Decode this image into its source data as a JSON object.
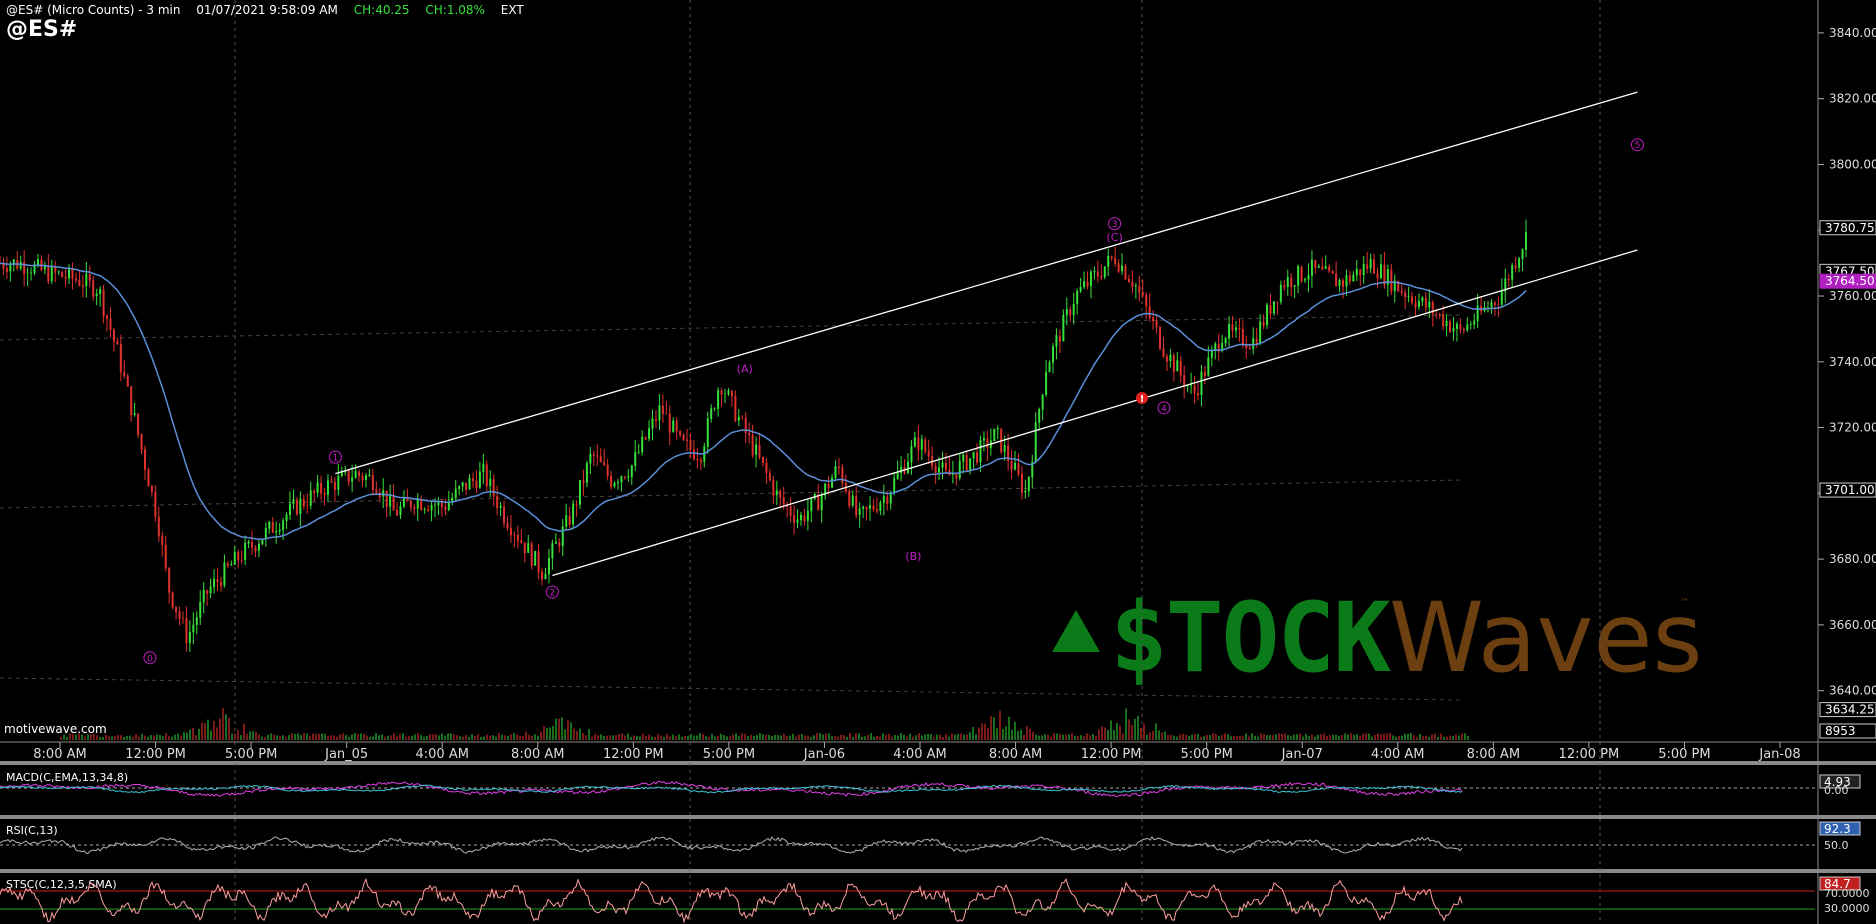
{
  "header": {
    "title": "@ES# (Micro Counts) - 3 min",
    "datetime": "01/07/2021 9:58:09 AM",
    "change": "CH:40.25",
    "change_pct": "CH:1.08%",
    "session": "EXT",
    "symbol": "@ES#"
  },
  "watermark": {
    "source": "motivewave.com",
    "logo_stock": "$TOCK",
    "logo_waves": "Waves",
    "logo_tm": "™"
  },
  "colors": {
    "background": "#000000",
    "up_candle": "#37e13c",
    "down_candle": "#e0322d",
    "ma_line": "#5b8fd8",
    "wave_label": "#c21dc6",
    "channel": "#ffffff",
    "macd": "#e040e8",
    "rsi": "#b0b0b0",
    "stoch": "#ff9f9f"
  },
  "chart_data": {
    "type": "candlestick",
    "title": "@ES# (Micro Counts) - 3 min",
    "ylim": [
      3625,
      3850
    ],
    "y_ticks": [
      3640,
      3660,
      3680,
      3700,
      3720,
      3740,
      3760,
      3780,
      3800,
      3820,
      3840
    ],
    "x_ticks": [
      "8:00 AM",
      "12:00 PM",
      "5:00 PM",
      "Jan_05",
      "4:00 AM",
      "8:00 AM",
      "12:00 PM",
      "5:00 PM",
      "Jan-06",
      "4:00 AM",
      "8:00 AM",
      "12:00 PM",
      "5:00 PM",
      "Jan-07",
      "4:00 AM",
      "8:00 AM",
      "12:00 PM",
      "5:00 PM",
      "Jan-08"
    ],
    "price_labels": [
      {
        "text": "3780.75",
        "value": 3780.75,
        "style": "last"
      },
      {
        "text": "3767.50",
        "value": 3767.5,
        "style": "plain"
      },
      {
        "text": "3764.50",
        "value": 3764.5,
        "style": "magenta"
      },
      {
        "text": "3701.00",
        "value": 3701.0,
        "style": "plain"
      },
      {
        "text": "3634.25",
        "value": 3634.25,
        "style": "plain"
      },
      {
        "text": "8953",
        "value": 8953,
        "style": "volume"
      }
    ],
    "path": {
      "t": [
        0,
        2,
        5,
        8,
        10,
        12,
        14,
        16,
        17,
        19,
        21,
        24,
        27,
        30,
        33,
        36,
        38,
        40,
        42,
        45,
        47,
        49,
        51,
        53,
        55,
        58,
        60,
        62,
        64,
        67,
        69,
        71,
        73,
        76,
        79,
        81,
        83,
        85,
        87,
        90,
        93,
        96,
        99,
        101,
        104,
        106,
        109,
        111,
        113,
        115,
        118,
        121,
        124,
        127,
        130,
        133,
        136,
        139,
        142,
        145,
        148,
        152,
        155
      ],
      "price": [
        3770,
        3770,
        3767,
        3765,
        3762,
        3742,
        3718,
        3692,
        3672,
        3656,
        3670,
        3680,
        3688,
        3696,
        3702,
        3706,
        3704,
        3694,
        3698,
        3696,
        3702,
        3706,
        3694,
        3685,
        3676,
        3694,
        3712,
        3704,
        3708,
        3726,
        3715,
        3712,
        3734,
        3716,
        3698,
        3692,
        3698,
        3708,
        3692,
        3700,
        3716,
        3705,
        3712,
        3718,
        3700,
        3738,
        3760,
        3766,
        3772,
        3764,
        3744,
        3730,
        3749,
        3746,
        3764,
        3768,
        3764,
        3770,
        3762,
        3756,
        3749,
        3760,
        3780
      ]
    },
    "channel_lines": [
      {
        "from": {
          "t": 34,
          "price": 3706
        },
        "to": {
          "t": 166,
          "price": 3822
        }
      },
      {
        "from": {
          "t": 56,
          "price": 3675
        },
        "to": {
          "t": 166,
          "price": 3774
        }
      }
    ],
    "wave_labels": [
      {
        "text": "0",
        "t": 15.2,
        "price": 3650
      },
      {
        "text": "1",
        "t": 34,
        "price": 3711
      },
      {
        "text": "2",
        "t": 56,
        "price": 3670
      },
      {
        "text": "(A)",
        "t": 75.5,
        "price": 3738
      },
      {
        "text": "(B)",
        "t": 92.6,
        "price": 3681
      },
      {
        "text": "(C)",
        "t": 113,
        "price": 3778
      },
      {
        "text": "3",
        "t": 113,
        "price": 3782
      },
      {
        "text": "4",
        "t": 118,
        "price": 3726
      },
      {
        "text": "5",
        "t": 166,
        "price": 3806
      }
    ],
    "panels": [
      {
        "label": "MACD(C,EMA,13,34,8)",
        "value": "4.93",
        "ref": "0.00"
      },
      {
        "label": "RSI(C,13)",
        "value": "92.3",
        "ref": "50.0"
      },
      {
        "label": "STSC(C,12,3,5,SMA)",
        "value": "84.7",
        "ref": "70.0000",
        "ref2": "30.0000"
      }
    ]
  }
}
